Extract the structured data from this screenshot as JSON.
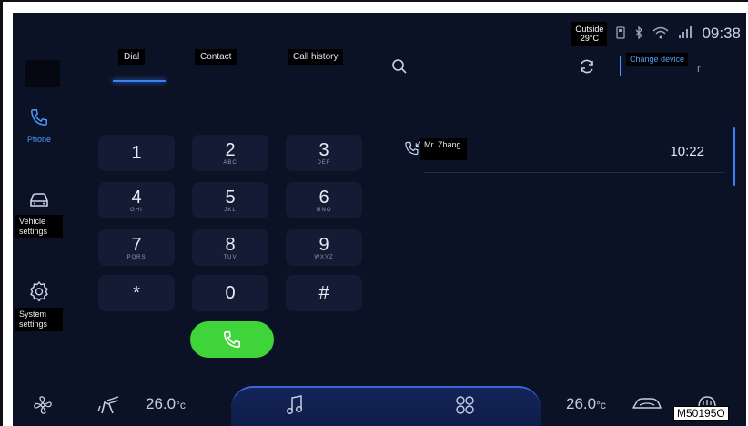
{
  "status": {
    "outside_label": "Outside",
    "outside_temp": "29°C",
    "time": "09:38",
    "icons": [
      "usb-icon",
      "bluetooth-icon",
      "wifi-icon",
      "signal-icon"
    ]
  },
  "sidebar": {
    "items": [
      {
        "label": "Phone",
        "icon": "phone-icon",
        "active": true
      },
      {
        "label": "Vehicle settings",
        "icon": "car-icon",
        "active": false
      },
      {
        "label": "System settings",
        "icon": "gear-icon",
        "active": false
      }
    ]
  },
  "tabs": [
    {
      "label": "Dial",
      "active": true
    },
    {
      "label": "Contact",
      "active": false
    },
    {
      "label": "Call history",
      "active": false
    }
  ],
  "header": {
    "change_device": "Change device",
    "change_tail": "r"
  },
  "keypad": [
    {
      "digit": "1",
      "letters": ""
    },
    {
      "digit": "2",
      "letters": "ABC"
    },
    {
      "digit": "3",
      "letters": "DEF"
    },
    {
      "digit": "4",
      "letters": "GHI"
    },
    {
      "digit": "5",
      "letters": "JKL"
    },
    {
      "digit": "6",
      "letters": "MNO"
    },
    {
      "digit": "7",
      "letters": "PQRS"
    },
    {
      "digit": "8",
      "letters": "TUV"
    },
    {
      "digit": "9",
      "letters": "WXYZ"
    },
    {
      "digit": "*",
      "letters": ""
    },
    {
      "digit": "0",
      "letters": ""
    },
    {
      "digit": "#",
      "letters": ""
    }
  ],
  "history": [
    {
      "name": "Mr. Zhang",
      "time": "10:22",
      "type": "incoming"
    }
  ],
  "bottom": {
    "left_temp": "26.0",
    "right_temp": "26.0",
    "temp_unit": "°c"
  },
  "watermark": "M50195O",
  "colors": {
    "accent": "#3b82f6",
    "call_green": "#3fd43a",
    "background": "#0c1226"
  }
}
